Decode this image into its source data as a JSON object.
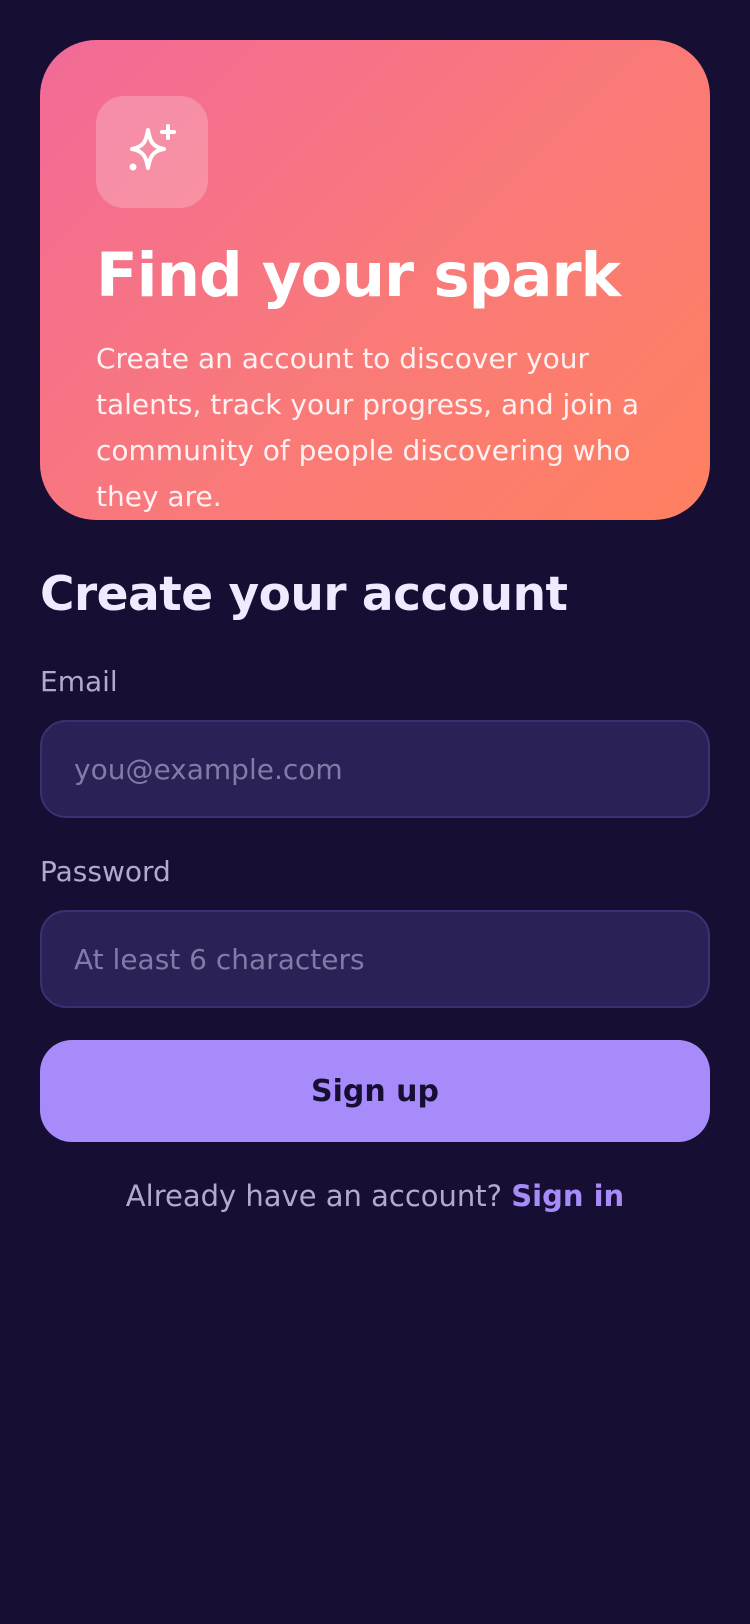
{
  "hero": {
    "icon": "sparkles-icon",
    "title": "Find your spark",
    "description": "Create an account to discover your talents, track your progress, and join a community of people discovering who they are."
  },
  "form": {
    "title": "Create your account",
    "email": {
      "label": "Email",
      "value": "",
      "placeholder": "you@example.com"
    },
    "password": {
      "label": "Password",
      "value": "",
      "placeholder": "At least 6 characters"
    },
    "submit_label": "Sign up"
  },
  "footer": {
    "prompt": "Already have an account?",
    "signin_label": "Sign in"
  },
  "colors": {
    "background": "#160f33",
    "hero_gradient_start": "#f26a98",
    "hero_gradient_end": "#ff8060",
    "accent": "#a88bfa",
    "input_background": "#2a2256",
    "muted_text": "#b2aacc"
  }
}
